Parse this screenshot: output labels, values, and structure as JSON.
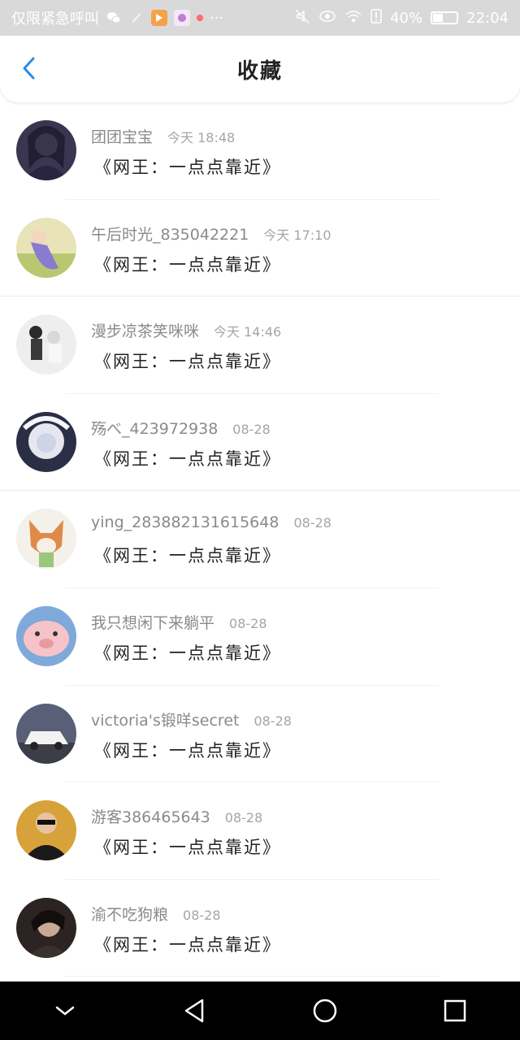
{
  "status_bar": {
    "left_text": "仅限紧急呼叫",
    "battery_percent": "40%",
    "time": "22:04",
    "icons": [
      "wechat-icon",
      "play-icon",
      "app-icon",
      "dot-icon",
      "more-icon",
      "mute-icon",
      "eye-icon",
      "wifi-icon",
      "alert-icon",
      "battery-icon"
    ]
  },
  "header": {
    "title": "收藏",
    "back_icon": "chevron-left-icon"
  },
  "favorites": [
    {
      "name": "团团宝宝",
      "time": "今天 18:48",
      "title": "《网王：一点点靠近》"
    },
    {
      "name": "午后时光_835042221",
      "time": "今天 17:10",
      "title": "《网王：一点点靠近》"
    },
    {
      "name": "漫步凉茶笑咪咪",
      "time": "今天 14:46",
      "title": "《网王：一点点靠近》"
    },
    {
      "name": "殇べ_423972938",
      "time": "08-28",
      "title": "《网王：一点点靠近》"
    },
    {
      "name": "ying_283882131615648",
      "time": "08-28",
      "title": "《网王：一点点靠近》"
    },
    {
      "name": "我只想闲下来躺平",
      "time": "08-28",
      "title": "《网王：一点点靠近》"
    },
    {
      "name": "victoria's锻咩secret",
      "time": "08-28",
      "title": "《网王：一点点靠近》"
    },
    {
      "name": "游客386465643",
      "time": "08-28",
      "title": "《网王：一点点靠近》"
    },
    {
      "name": "渝不吃狗粮",
      "time": "08-28",
      "title": "《网王：一点点靠近》"
    }
  ],
  "nav_bar": {
    "buttons": [
      "collapse-icon",
      "back-triangle-icon",
      "home-circle-icon",
      "recents-square-icon"
    ]
  },
  "colors": {
    "status_bar_bg": "#d9d9d9",
    "accent_blue": "#2a8ce8",
    "name_gray": "#8a8a8a",
    "nav_bg": "#000000"
  }
}
